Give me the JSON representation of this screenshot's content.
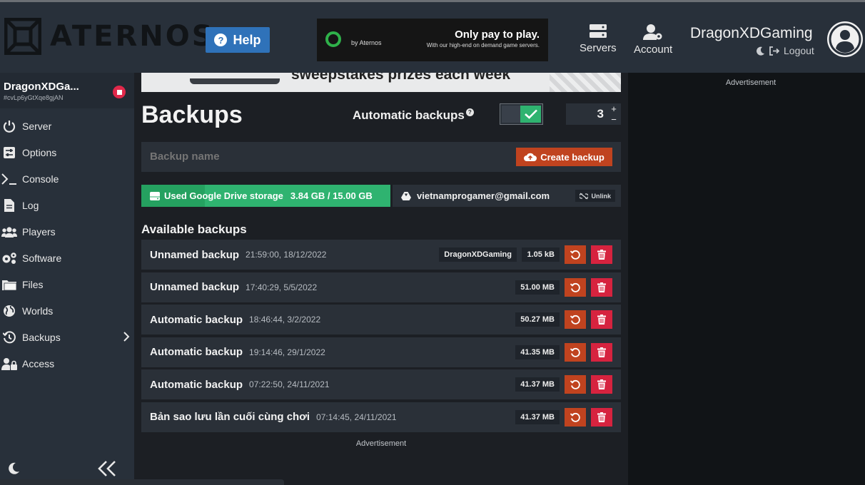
{
  "header": {
    "logo_text": "ATERNOS",
    "help_label": "Help",
    "ad": {
      "by": "by Aternos",
      "headline": "Only pay to play.",
      "sub": "With our high-end on demand game servers."
    },
    "nav": {
      "servers": "Servers",
      "account": "Account"
    },
    "username": "DragonXDGaming",
    "logout": "Logout"
  },
  "sidebar": {
    "server_name": "DragonXDGa...",
    "server_id": "#cvLp6yGtXqe8gjAN",
    "items": [
      {
        "label": "Server",
        "icon": "power-icon"
      },
      {
        "label": "Options",
        "icon": "sliders-icon"
      },
      {
        "label": "Console",
        "icon": "terminal-icon"
      },
      {
        "label": "Log",
        "icon": "file-icon"
      },
      {
        "label": "Players",
        "icon": "users-icon"
      },
      {
        "label": "Software",
        "icon": "gears-icon"
      },
      {
        "label": "Files",
        "icon": "folder-icon"
      },
      {
        "label": "Worlds",
        "icon": "globe-icon"
      },
      {
        "label": "Backups",
        "icon": "history-icon"
      },
      {
        "label": "Access",
        "icon": "user-lock-icon"
      }
    ]
  },
  "main": {
    "ad_strip_text": "sweepstakes prizes each week",
    "title": "Backups",
    "auto_backups_label": "Automatic backups",
    "auto_backups_help": "?",
    "auto_backups_enabled": true,
    "backup_limit": "3",
    "backup_name_placeholder": "Backup name",
    "create_backup_label": "Create backup",
    "drive": {
      "label": "Used Google Drive storage",
      "usage": "3.84 GB / 15.00 GB",
      "used_fraction": 0.256
    },
    "email": "vietnamprogamer@gmail.com",
    "unlink_label": "Unlink",
    "available_title": "Available backups",
    "backups": [
      {
        "name": "Unnamed backup",
        "date": "21:59:00, 18/12/2022",
        "owner": "DragonXDGaming",
        "size": "1.05 kB"
      },
      {
        "name": "Unnamed backup",
        "date": "17:40:29, 5/5/2022",
        "owner": "",
        "size": "51.00 MB"
      },
      {
        "name": "Automatic backup",
        "date": "18:46:44, 3/2/2022",
        "owner": "",
        "size": "50.27 MB"
      },
      {
        "name": "Automatic backup",
        "date": "19:14:46, 29/1/2022",
        "owner": "",
        "size": "41.35 MB"
      },
      {
        "name": "Automatic backup",
        "date": "07:22:50, 24/11/2021",
        "owner": "",
        "size": "41.37 MB"
      },
      {
        "name": "Bản sao lưu lần cuối cùng chơi",
        "date": "07:14:45, 24/11/2021",
        "owner": "",
        "size": "41.37 MB"
      }
    ],
    "ad_label": "Advertisement"
  },
  "right": {
    "ad_label": "Advertisement"
  },
  "colors": {
    "header": "#28303a",
    "accent_blue": "#2f72b9",
    "green": "#2fb370",
    "orange": "#c0431f",
    "red": "#d6233f"
  }
}
